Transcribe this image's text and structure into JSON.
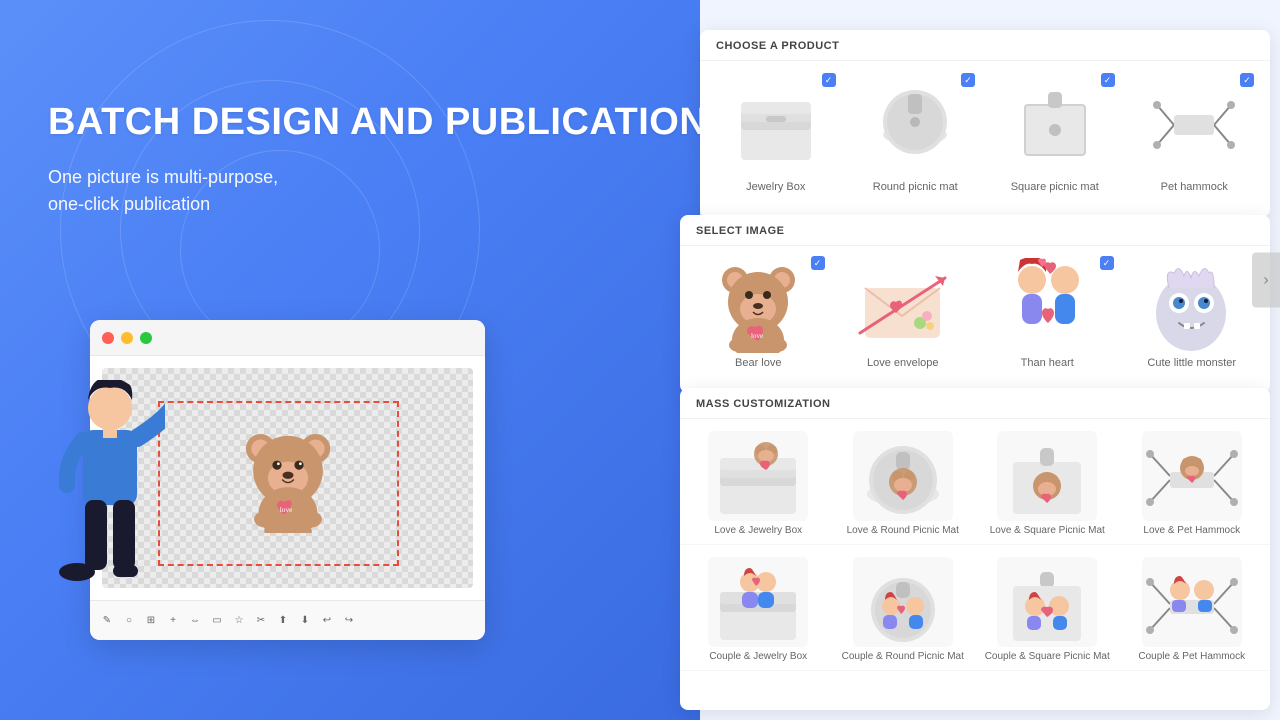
{
  "background": {
    "left_color": "#4a7ff5",
    "right_color": "#f0f4ff"
  },
  "left": {
    "title": "BATCH DESIGN AND PUBLICATION",
    "subtitle_line1": "One picture is multi-purpose,",
    "subtitle_line2": "one-click publication"
  },
  "editor": {
    "dots": [
      "red",
      "yellow",
      "green"
    ],
    "toolbar_icons": [
      "✏️",
      "⭕",
      "🔲",
      "➕",
      "⬚",
      "⬜",
      "✦",
      "✂",
      "⬆",
      "⬇",
      "↩",
      "↪"
    ]
  },
  "panel_choose": {
    "header": "CHOOSE A PRODUCT",
    "products": [
      {
        "id": "jewelry-box",
        "label": "Jewelry Box",
        "checked": true
      },
      {
        "id": "round-picnic-mat",
        "label": "Round picnic mat",
        "checked": true
      },
      {
        "id": "square-picnic-mat",
        "label": "Square picnic mat",
        "checked": true
      },
      {
        "id": "pet-hammock",
        "label": "Pet hammock",
        "checked": true
      }
    ]
  },
  "panel_select": {
    "header": "SELECT IMAGE",
    "images": [
      {
        "id": "bear-love",
        "label": "Bear love",
        "checked": true
      },
      {
        "id": "love-envelope",
        "label": "Love envelope",
        "checked": false
      },
      {
        "id": "than-heart",
        "label": "Than heart",
        "checked": true
      },
      {
        "id": "cute-little-monster",
        "label": "Cute little monster",
        "checked": false
      }
    ]
  },
  "panel_mass": {
    "header": "MASS CUSTOMIZATION",
    "rows": [
      [
        {
          "label": "Love & Jewelry Box"
        },
        {
          "label": "Love & Round Picnic Mat"
        },
        {
          "label": "Love & Square Picnic Mat"
        },
        {
          "label": "Love & Pet Hammock"
        }
      ],
      [
        {
          "label": "Couple & Jewelry Box"
        },
        {
          "label": "Couple & Round Picnic Mat"
        },
        {
          "label": "Couple & Square Picnic Mat"
        },
        {
          "label": "Couple & Pet Hammock"
        }
      ]
    ]
  }
}
